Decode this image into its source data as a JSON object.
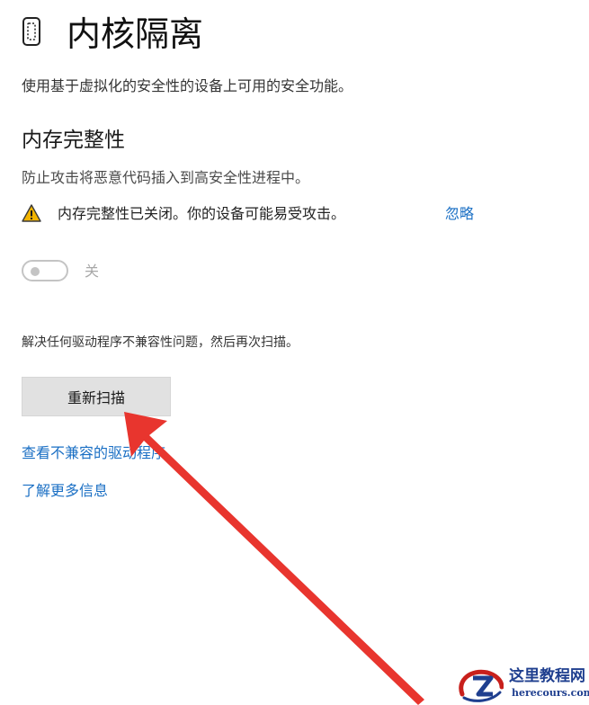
{
  "header": {
    "title": "内核隔离",
    "icon": "chip-icon",
    "subtitle": "使用基于虚拟化的安全性的设备上可用的安全功能。"
  },
  "memory_integrity": {
    "title": "内存完整性",
    "description": "防止攻击将恶意代码插入到高安全性进程中。",
    "warning": {
      "icon": "warning-icon",
      "text": "内存完整性已关闭。你的设备可能易受攻击。",
      "dismiss_label": "忽略"
    },
    "toggle": {
      "state": "off",
      "label": "关"
    }
  },
  "driver": {
    "resolve_text": "解决任何驱动程序不兼容性问题，然后再次扫描。",
    "rescan_label": "重新扫描",
    "incompatible_link": "查看不兼容的驱动程序",
    "learn_more_link": "了解更多信息"
  },
  "watermark": {
    "site_name": "这里教程网",
    "site_domain": "herecours.com"
  },
  "colors": {
    "link": "#1a6fc4",
    "button_bg": "#e1e1e1",
    "arrow": "#e8352e",
    "warning": "#f2b400"
  }
}
